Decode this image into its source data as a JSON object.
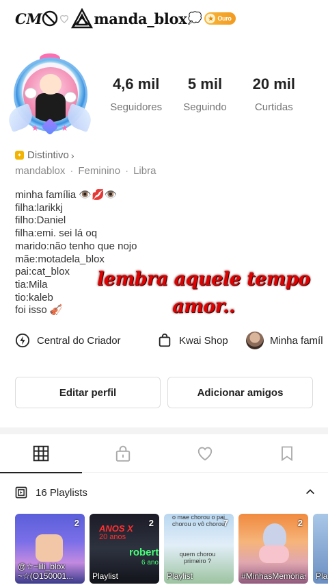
{
  "profile": {
    "handle_prefix": "CM",
    "handle": "manda_blox",
    "cloud_emoji": "💭",
    "badge_label": "Ouro"
  },
  "stats": [
    {
      "value": "4,6 mil",
      "label": "Seguidores"
    },
    {
      "value": "5 mil",
      "label": "Seguindo"
    },
    {
      "value": "20 mil",
      "label": "Curtidas"
    }
  ],
  "distintivo": {
    "label": "Distintivo",
    "chevron": "›"
  },
  "meta": {
    "username": "mandablox",
    "gender": "Feminino",
    "sign": "Libra",
    "separator": "·"
  },
  "bio": [
    "minha família 👁️💋👁️",
    "filha:larikkj",
    "filho:Daniel",
    "filha:emi. sei lá oq",
    "marido:não tenho que nojo",
    "mãe:motadela_blox",
    "pai:cat_blox",
    "tia:Mila",
    "tio:kaleb",
    "foi isso 🎻"
  ],
  "overlay": {
    "line1": "lembra aquele tempo",
    "line2": "amor.."
  },
  "quicklinks": [
    {
      "label": "Central do Criador",
      "icon": "bolt-circle-icon"
    },
    {
      "label": "Kwai Shop",
      "icon": "shopping-bag-icon"
    },
    {
      "label": "Minha famíl",
      "icon": "group-avatar-icon"
    }
  ],
  "buttons": {
    "edit": "Editar perfil",
    "add_friends": "Adicionar amigos"
  },
  "tabs": [
    {
      "name": "grid",
      "icon": "grid-icon",
      "active": true
    },
    {
      "name": "private",
      "icon": "lock-icon",
      "active": false
    },
    {
      "name": "liked",
      "icon": "heart-icon",
      "active": false
    },
    {
      "name": "saved",
      "icon": "bookmark-icon",
      "active": false
    }
  ],
  "playlists": {
    "title": "16 Playlists",
    "items": [
      {
        "count": "2",
        "caption": "@☆~lili_blox ~☆(O150001..."
      },
      {
        "count": "2",
        "caption": "Playlist",
        "tag1": "ANOS X",
        "tag2": "20 anos",
        "tag3": "robert",
        "tag4": "6 ano"
      },
      {
        "count": "7",
        "caption": "Playlist",
        "text_top": "o mae chorou o pai chorou o vô chorou",
        "text_mid": "quem chorou primeiro ?"
      },
      {
        "count": "2",
        "caption": "#MinhasMemóriasdeumÚni..."
      },
      {
        "count": "",
        "caption": "Pla"
      }
    ]
  },
  "colors": {
    "gold": "#f29a1f",
    "overlay_red": "#e00000",
    "accent_text": "#222222"
  }
}
